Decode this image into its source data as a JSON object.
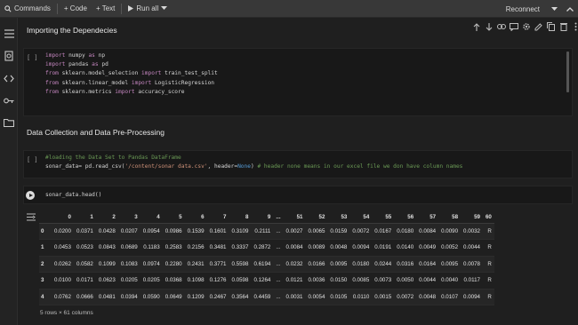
{
  "toolbar": {
    "commands": "Commands",
    "add_code": "+ Code",
    "add_text": "+ Text",
    "run_all": "Run all",
    "reconnect": "Reconnect"
  },
  "sections": {
    "import_heading": "Importing the Dependecies",
    "data_heading": "Data Collection and Data Pre-Processing"
  },
  "cells": {
    "import_bracket": "[ ]",
    "data_bracket": "[ ]",
    "head_code": "sonar_data.head()"
  },
  "dataframe": {
    "columns": [
      "",
      "0",
      "1",
      "2",
      "3",
      "4",
      "5",
      "6",
      "7",
      "8",
      "9",
      "...",
      "51",
      "52",
      "53",
      "54",
      "55",
      "56",
      "57",
      "58",
      "59",
      "60"
    ],
    "rows": [
      [
        "0",
        "0.0200",
        "0.0371",
        "0.0428",
        "0.0207",
        "0.0954",
        "0.0986",
        "0.1539",
        "0.1601",
        "0.3109",
        "0.2111",
        "...",
        "0.0027",
        "0.0065",
        "0.0159",
        "0.0072",
        "0.0167",
        "0.0180",
        "0.0084",
        "0.0090",
        "0.0032",
        "R"
      ],
      [
        "1",
        "0.0453",
        "0.0523",
        "0.0843",
        "0.0689",
        "0.1183",
        "0.2583",
        "0.2156",
        "0.3481",
        "0.3337",
        "0.2872",
        "...",
        "0.0084",
        "0.0089",
        "0.0048",
        "0.0094",
        "0.0191",
        "0.0140",
        "0.0049",
        "0.0052",
        "0.0044",
        "R"
      ],
      [
        "2",
        "0.0262",
        "0.0582",
        "0.1099",
        "0.1083",
        "0.0974",
        "0.2280",
        "0.2431",
        "0.3771",
        "0.5598",
        "0.6194",
        "...",
        "0.0232",
        "0.0166",
        "0.0095",
        "0.0180",
        "0.0244",
        "0.0316",
        "0.0164",
        "0.0095",
        "0.0078",
        "R"
      ],
      [
        "3",
        "0.0100",
        "0.0171",
        "0.0623",
        "0.0205",
        "0.0205",
        "0.0368",
        "0.1098",
        "0.1276",
        "0.0598",
        "0.1264",
        "...",
        "0.0121",
        "0.0036",
        "0.0150",
        "0.0085",
        "0.0073",
        "0.0050",
        "0.0044",
        "0.0040",
        "0.0117",
        "R"
      ],
      [
        "4",
        "0.0762",
        "0.0666",
        "0.0481",
        "0.0394",
        "0.0590",
        "0.0649",
        "0.1209",
        "0.2467",
        "0.3564",
        "0.4459",
        "...",
        "0.0031",
        "0.0054",
        "0.0105",
        "0.0110",
        "0.0015",
        "0.0072",
        "0.0048",
        "0.0107",
        "0.0094",
        "R"
      ]
    ],
    "shape": "5 rows × 61 columns"
  },
  "icons": {
    "rail": [
      "menu-icon",
      "search-icon",
      "code-icon",
      "key-icon",
      "folder-icon"
    ],
    "cell_toolbar": [
      "arrow-up-icon",
      "arrow-down-icon",
      "link-icon",
      "comment-icon",
      "settings-icon",
      "edit-icon",
      "copy-icon",
      "delete-icon",
      "more-icon"
    ]
  },
  "colors": {
    "background": "#1f1f1f",
    "toolbar": "#383838",
    "code_cell": "#181818",
    "keyword": "#c586c0",
    "builtin": "#569cd6",
    "comment": "#6a9955",
    "string": "#ce9178"
  }
}
